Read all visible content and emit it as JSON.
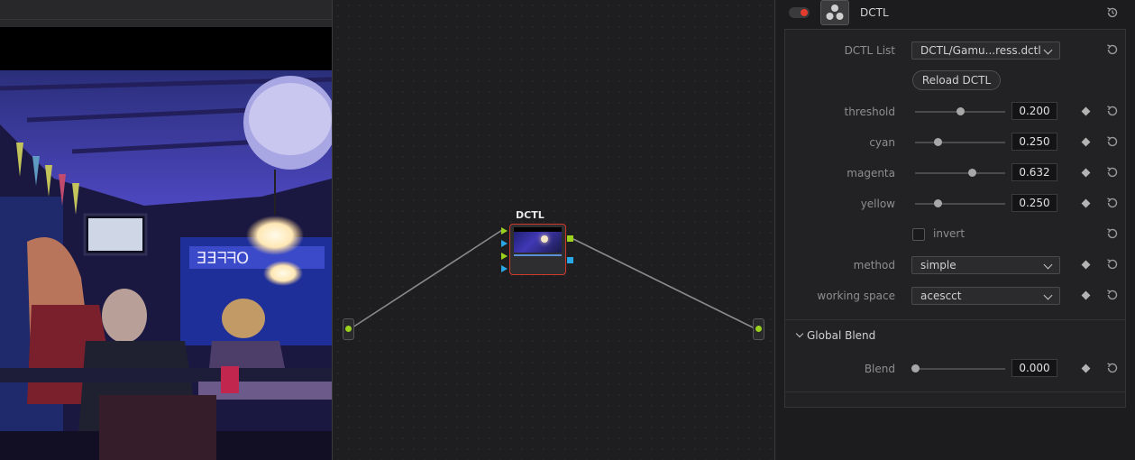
{
  "viewer": {
    "image_description_icon": "bar-interior-photo"
  },
  "node_graph": {
    "node_label": "DCTL",
    "input_pin_icon": "green-dot-icon",
    "output_pin_icon": "green-dot-icon"
  },
  "inspector": {
    "title": "DCTL",
    "enable_toggle_state": "on",
    "dctl_list": {
      "label": "DCTL List",
      "value": "DCTL/Gamu...ress.dctl"
    },
    "reload_button": "Reload DCTL",
    "sliders": [
      {
        "label": "threshold",
        "value": "0.200",
        "fraction": 0.5
      },
      {
        "label": "cyan",
        "value": "0.250",
        "fraction": 0.25
      },
      {
        "label": "magenta",
        "value": "0.632",
        "fraction": 0.632
      },
      {
        "label": "yellow",
        "value": "0.250",
        "fraction": 0.25
      }
    ],
    "invert": {
      "label": "invert",
      "checked": false
    },
    "method": {
      "label": "method",
      "value": "simple"
    },
    "working_space": {
      "label": "working space",
      "value": "acescct"
    },
    "global_blend": {
      "title": "Global Blend",
      "blend": {
        "label": "Blend",
        "value": "0.000",
        "fraction": 0.0
      }
    }
  },
  "colors": {
    "accent_red": "#e33b2e",
    "pin_green": "#9ad21e",
    "pin_blue": "#2aa7e6",
    "node_border": "#d13a2b"
  }
}
